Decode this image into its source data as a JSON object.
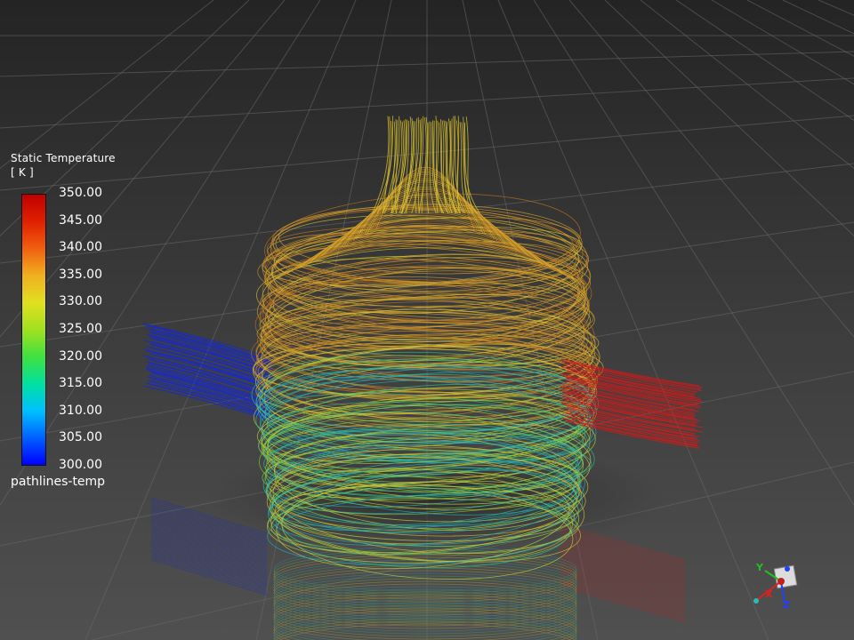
{
  "legend": {
    "title": "Static Temperature",
    "unit": "[ K ]",
    "name": "pathlines-temp",
    "min": 300.0,
    "max": 350.0,
    "ticks": [
      "350.00",
      "345.00",
      "340.00",
      "335.00",
      "330.00",
      "325.00",
      "320.00",
      "315.00",
      "310.00",
      "305.00",
      "300.00"
    ],
    "colormap": [
      "#0000ff",
      "#0060ff",
      "#00c0ff",
      "#00e0a0",
      "#40e040",
      "#a0e020",
      "#e0e020",
      "#f0b020",
      "#f06010",
      "#e02000",
      "#c00000"
    ]
  },
  "triad": {
    "x_label": "X",
    "y_label": "Y",
    "z_label": "Z",
    "x_color": "#e02020",
    "y_color": "#20c020",
    "z_color": "#2040ff"
  },
  "scene": {
    "background_top": "#262626",
    "background_bottom": "#4a4a4a",
    "inlet_color": "#1428d8",
    "outlet_color": "#d81818",
    "outlet_body_colors": [
      "#d8c030",
      "#c89028",
      "#b87020",
      "#d8a030"
    ],
    "lower_body_colors": [
      "#20b0c0",
      "#30c090",
      "#80d040",
      "#c0d040",
      "#d8c030"
    ]
  }
}
